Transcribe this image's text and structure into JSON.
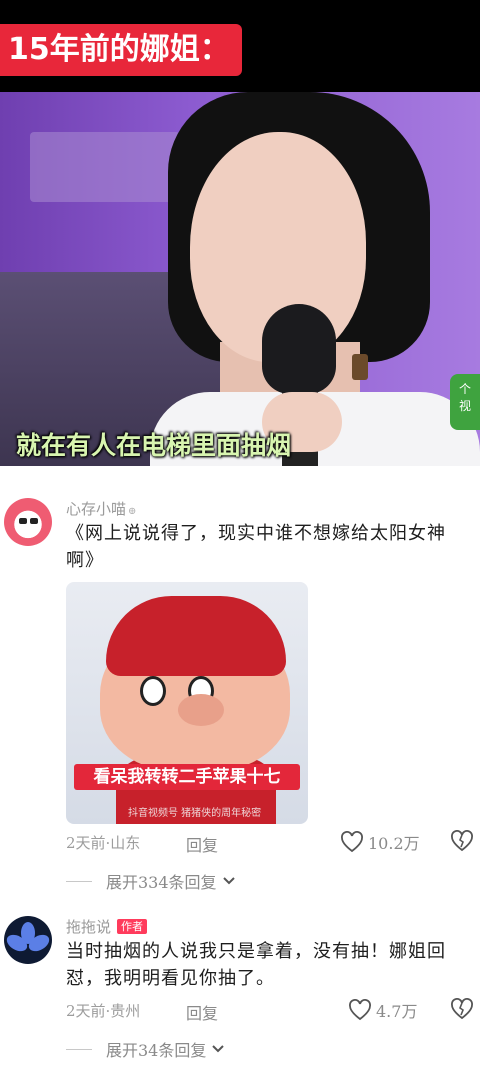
{
  "video": {
    "title": "15年前的娜姐：",
    "subtitle": "就在有人在电梯里面抽烟",
    "corner_logo_text": "个\n视"
  },
  "comments": [
    {
      "username": "心存小喵",
      "text": "《网上说说得了，现实中谁不想嫁给太阳女神啊》",
      "meme_caption": "看呆我转转二手苹果十七",
      "meme_watermark": "抖音视频号 猪猪侠的周年秘密",
      "time_location": "2天前·山东",
      "reply_label": "回复",
      "likes": "10.2万",
      "expand_label": "展开334条回复"
    },
    {
      "username": "拖拖说",
      "author_badge": "作者",
      "text": "当时抽烟的人说我只是拿着，没有抽！娜姐回怼，我明明看见你抽了。",
      "time_location": "2天前·贵州",
      "reply_label": "回复",
      "likes": "4.7万",
      "expand_label": "展开34条回复"
    }
  ],
  "colors": {
    "accent_red": "#e8273a",
    "author_badge": "#ff3b5c",
    "meta_gray": "#9d9d9d"
  }
}
